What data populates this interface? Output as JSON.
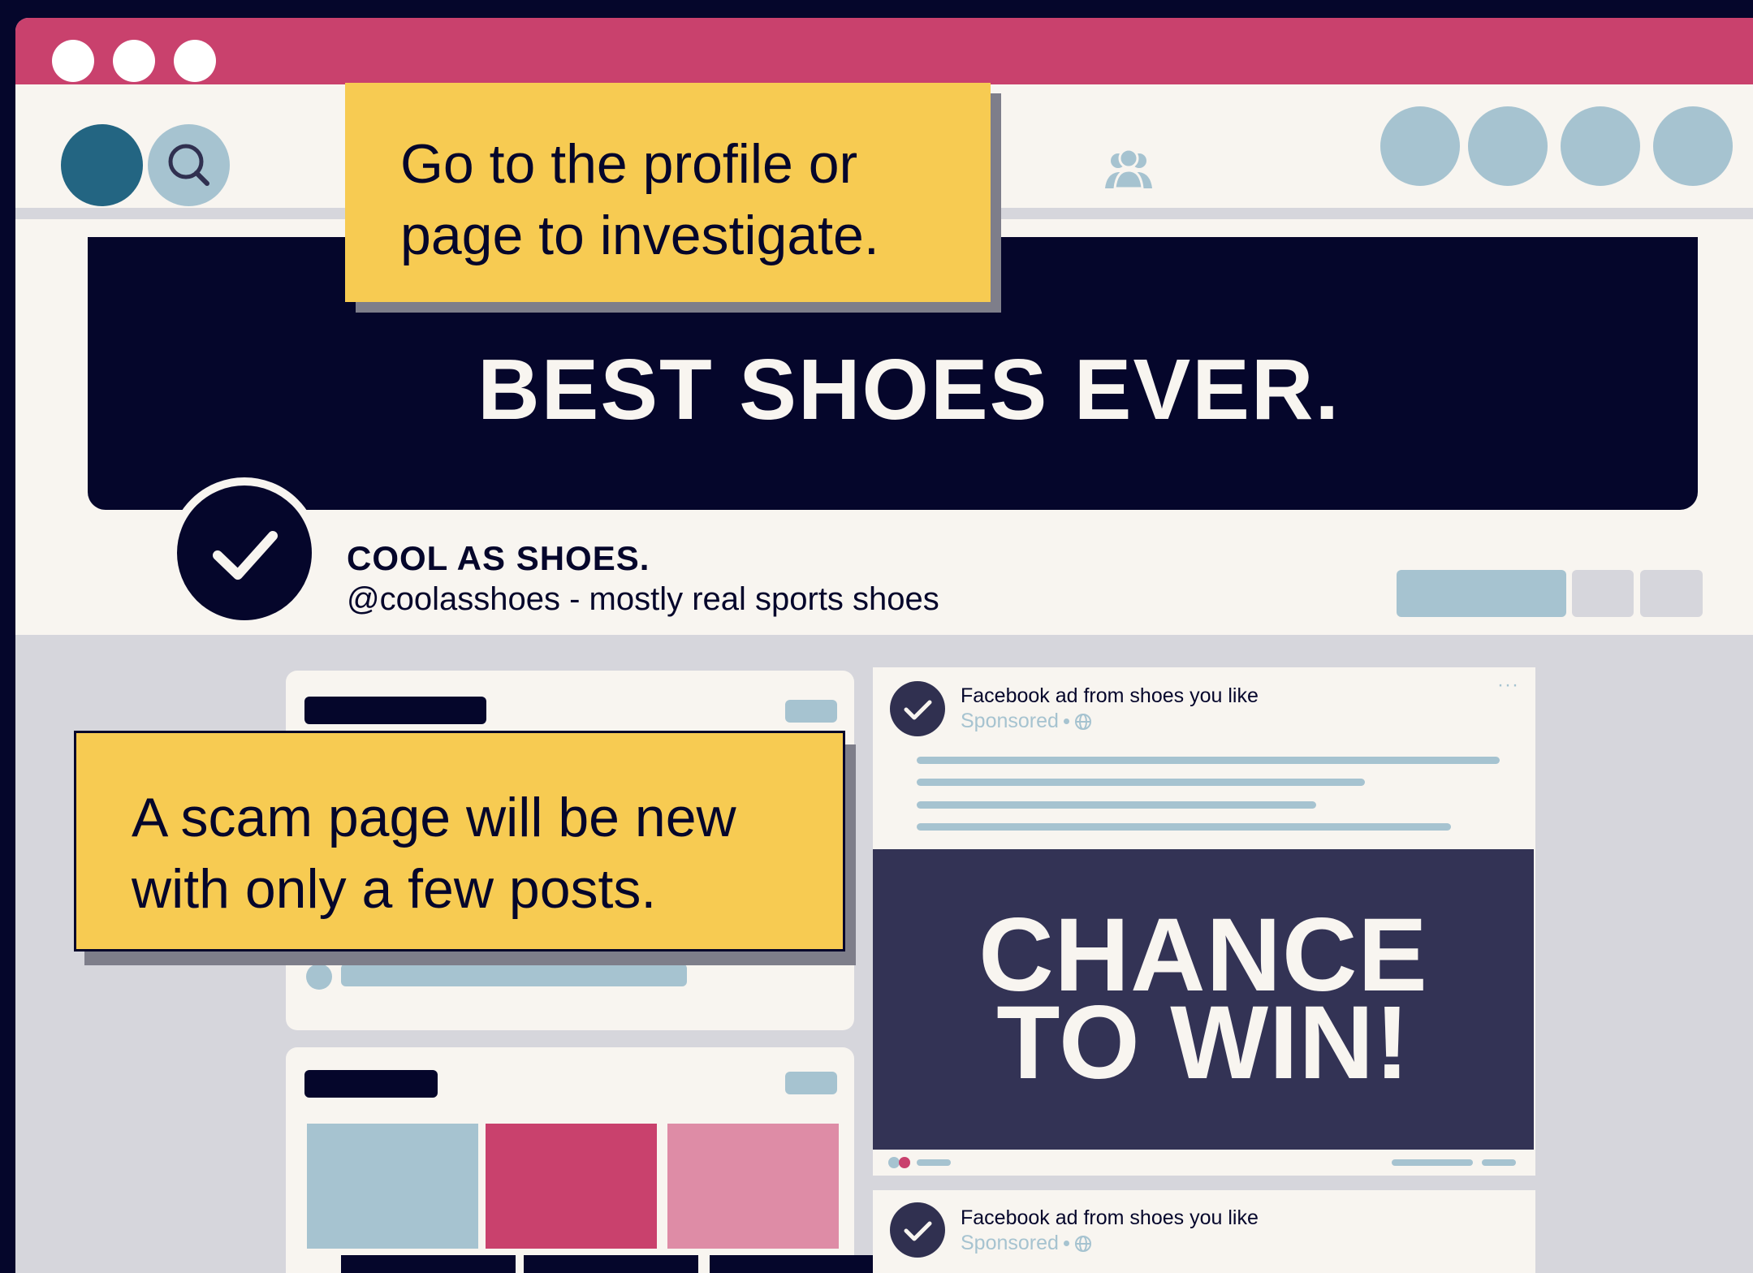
{
  "browser": {
    "window_dots": [
      "dot",
      "dot",
      "dot"
    ]
  },
  "navbar": {
    "home_icon": "home-circle-icon",
    "search_icon": "search-icon",
    "groups_icon": "people-group-icon",
    "right_circles": 4
  },
  "callouts": {
    "profile": "Go to the profile or page to investigate.",
    "profile_lines": [
      "Go to the profile or",
      "page to investigate."
    ],
    "scam": "A scam page will be new with only a few posts.",
    "scam_lines": [
      "A scam page will be new",
      "with only a few posts."
    ]
  },
  "banner": {
    "text": "BEST SHOES EVER."
  },
  "profile": {
    "name": "COOL AS SHOES.",
    "handle": "@coolasshoes - mostly real sports shoes",
    "avatar_icon": "check-icon"
  },
  "ads": [
    {
      "title": "Facebook ad from shoes you like",
      "sponsored": "Sponsored",
      "menu": "···",
      "image_text_lines": [
        "CHANCE",
        "TO WIN!"
      ]
    },
    {
      "title": "Facebook ad from shoes you like",
      "sponsored": "Sponsored"
    }
  ],
  "colors": {
    "dark_navy": "#05062b",
    "pink": "#c9416d",
    "light_pink": "#de8ca6",
    "light_blue": "#a6c3d0",
    "teal": "#236582",
    "yellow": "#f7cb52",
    "cream": "#f8f5f0",
    "gray": "#d6d6dc",
    "ad_purple": "#333355"
  }
}
